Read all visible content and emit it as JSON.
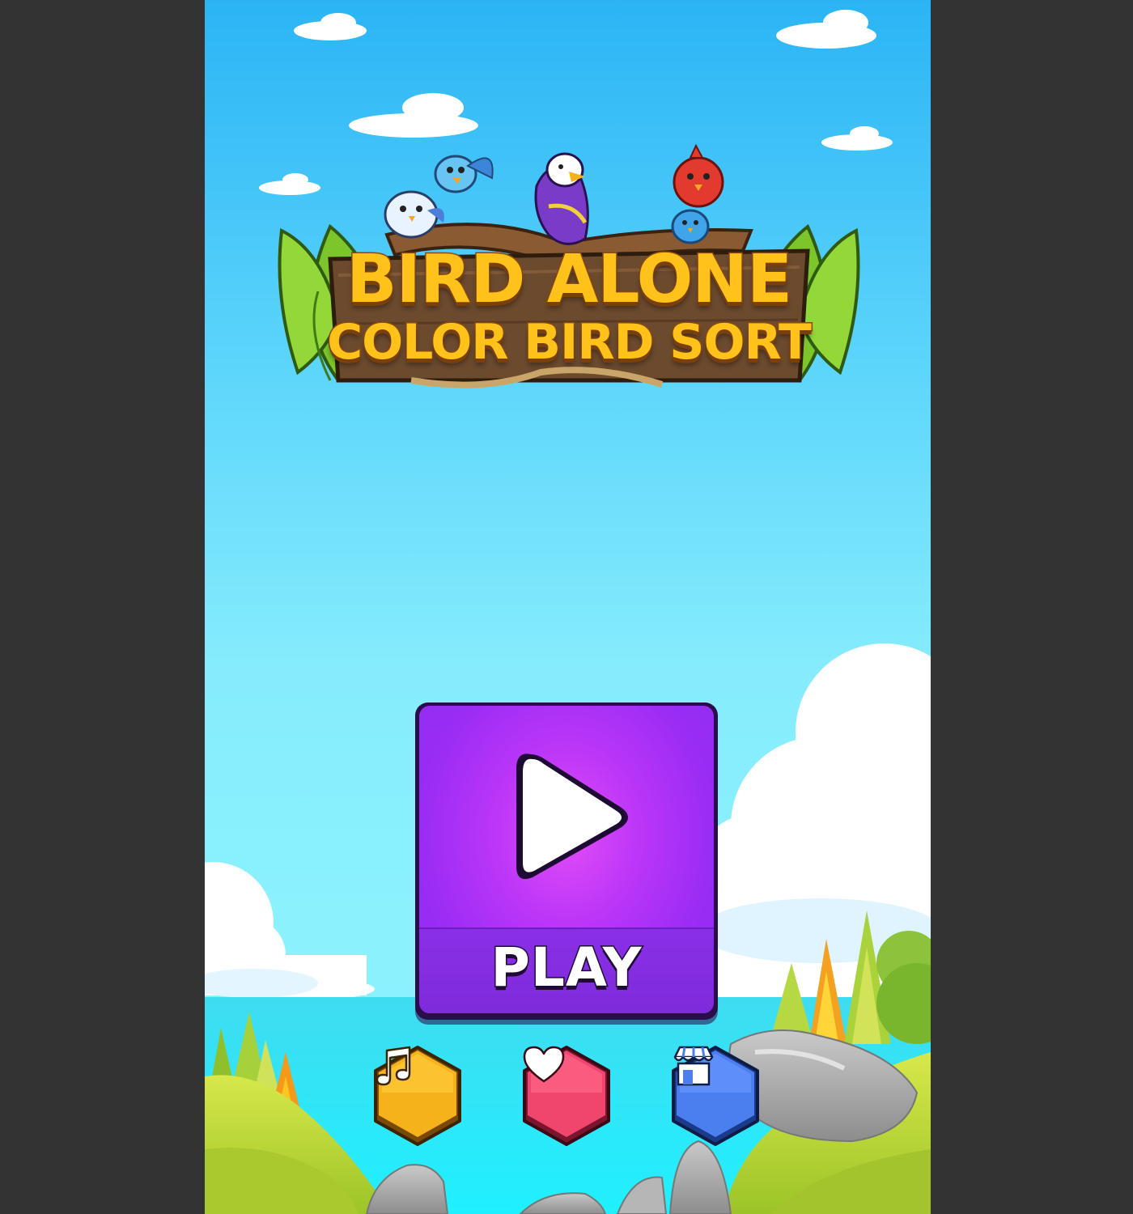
{
  "game": {
    "title_line1": "BIRD ALONE",
    "title_line2": "COLOR BIRD SORT"
  },
  "menu": {
    "play_label": "PLAY",
    "music_icon": "music-note-icon",
    "like_icon": "heart-icon",
    "shop_icon": "shop-icon"
  },
  "colors": {
    "play_button": "#9a2cf4",
    "music_button": "#f5b21a",
    "like_button": "#f0466e",
    "shop_button": "#4b7ff0"
  }
}
